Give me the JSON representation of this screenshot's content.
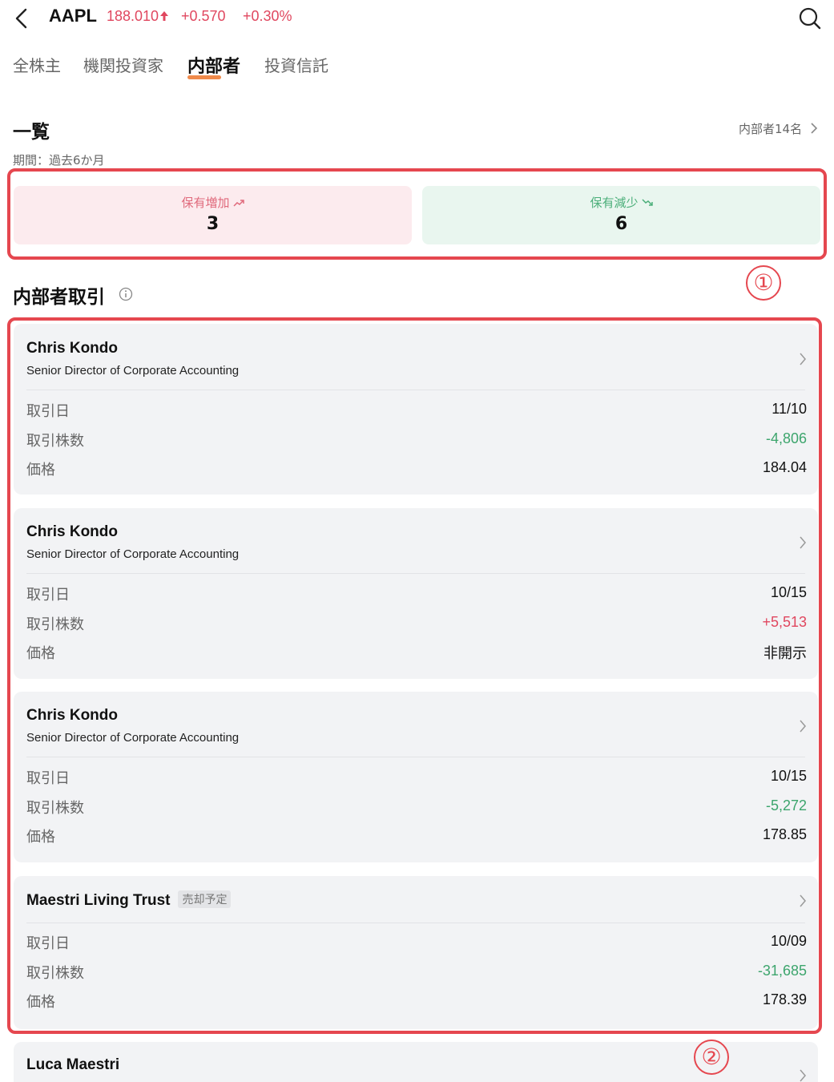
{
  "header": {
    "ticker": "AAPL",
    "price": "188.010",
    "change": "+0.570",
    "change_pct": "+0.30%"
  },
  "tabs": [
    {
      "label": "全株主",
      "active": false
    },
    {
      "label": "機関投資家",
      "active": false
    },
    {
      "label": "内部者",
      "active": true
    },
    {
      "label": "投資信託",
      "active": false
    }
  ],
  "overview": {
    "title": "一覧",
    "insider_count": "内部者14名",
    "period": "期間：過去6か月",
    "increase_label": "保有増加",
    "increase_value": "3",
    "decrease_label": "保有減少",
    "decrease_value": "6"
  },
  "annotations": {
    "first": "①",
    "second": "②"
  },
  "transactions": {
    "title": "内部者取引",
    "labels": {
      "date": "取引日",
      "shares": "取引株数",
      "price": "価格"
    },
    "items": [
      {
        "name": "Chris Kondo",
        "role": "Senior Director of Corporate Accounting",
        "date": "11/10",
        "shares": "-4,806",
        "price": "184.04"
      },
      {
        "name": "Chris Kondo",
        "role": "Senior Director of Corporate Accounting",
        "date": "10/15",
        "shares": "+5,513",
        "price": "非開示"
      },
      {
        "name": "Chris Kondo",
        "role": "Senior Director of Corporate Accounting",
        "date": "10/15",
        "shares": "-5,272",
        "price": "178.85"
      },
      {
        "name": "Maestri Living Trust",
        "badge": "売却予定",
        "date": "10/09",
        "shares": "-31,685",
        "price": "178.39"
      },
      {
        "name": "Luca Maestri"
      }
    ]
  },
  "colors": {
    "up": "#e0475f",
    "down": "#3da56d",
    "highlight": "#e5474f",
    "tab_underline": "#f08a4b"
  }
}
